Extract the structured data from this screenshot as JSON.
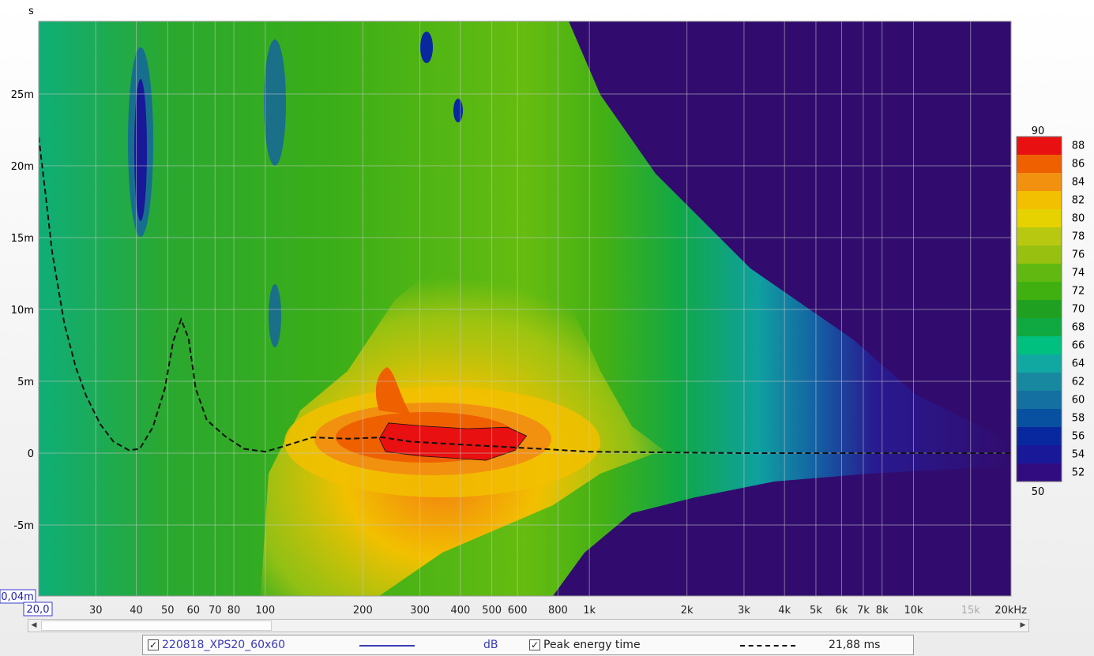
{
  "chart_data": {
    "type": "heatmap",
    "title": "",
    "x_axis": {
      "scale": "log",
      "range": [
        20,
        20000
      ],
      "start_label": "20,0",
      "tick_labels": [
        "30",
        "40",
        "50",
        "60",
        "70",
        "80",
        "100",
        "200",
        "300",
        "400",
        "500",
        "600",
        "800",
        "1k",
        "2k",
        "3k",
        "4k",
        "5k",
        "6k",
        "7k",
        "8k",
        "10k",
        "15k",
        "20kHz"
      ],
      "tick_values": [
        30,
        40,
        50,
        60,
        70,
        80,
        100,
        200,
        300,
        400,
        500,
        600,
        800,
        1000,
        2000,
        3000,
        4000,
        5000,
        6000,
        7000,
        8000,
        10000,
        15000,
        20000
      ]
    },
    "y_axis": {
      "unit_label": "s",
      "range": [
        -0.01,
        0.03
      ],
      "start_label": "0,04m",
      "tick_labels": [
        "25m",
        "20m",
        "15m",
        "10m",
        "5m",
        "0",
        "-5m"
      ],
      "tick_values": [
        0.025,
        0.02,
        0.015,
        0.01,
        0.005,
        0,
        -0.005
      ]
    },
    "color_scale": {
      "min_label": "50",
      "max_label": "90",
      "levels": [
        "88",
        "86",
        "84",
        "82",
        "80",
        "78",
        "76",
        "74",
        "72",
        "70",
        "68",
        "66",
        "64",
        "62",
        "60",
        "58",
        "56",
        "54",
        "52"
      ],
      "colors": [
        "#e81010",
        "#ee6000",
        "#f29010",
        "#f2c000",
        "#e6d200",
        "#b8c810",
        "#98c010",
        "#60b810",
        "#40b010",
        "#20a020",
        "#10a840",
        "#00c080",
        "#10a8a0",
        "#1888a0",
        "#1470a0",
        "#0850a0",
        "#0828a0",
        "#181898",
        "#300c80"
      ]
    },
    "peak_energy_time": {
      "points": [
        [
          20,
          0.022
        ],
        [
          21,
          0.018
        ],
        [
          22,
          0.014
        ],
        [
          24,
          0.009
        ],
        [
          26,
          0.006
        ],
        [
          28,
          0.004
        ],
        [
          31,
          0.002
        ],
        [
          34,
          0.0008
        ],
        [
          38,
          0.0002
        ],
        [
          41,
          0.0003
        ],
        [
          45,
          0.0018
        ],
        [
          49,
          0.0045
        ],
        [
          52,
          0.0078
        ],
        [
          55,
          0.0093
        ],
        [
          58,
          0.008
        ],
        [
          61,
          0.0045
        ],
        [
          66,
          0.0023
        ],
        [
          75,
          0.0012
        ],
        [
          86,
          0.0003
        ],
        [
          100,
          0.0001
        ],
        [
          115,
          0.0005
        ],
        [
          140,
          0.0011
        ],
        [
          180,
          0.001
        ],
        [
          230,
          0.0011
        ],
        [
          280,
          0.0008
        ],
        [
          400,
          0.0006
        ],
        [
          700,
          0.0003
        ],
        [
          1000,
          0.0001
        ],
        [
          3000,
          0
        ],
        [
          20000,
          0
        ]
      ]
    },
    "peak_region": [
      [
        225,
        0.001
      ],
      [
        240,
        0.0021
      ],
      [
        300,
        0.0019
      ],
      [
        420,
        0.0017
      ],
      [
        560,
        0.0018
      ],
      [
        640,
        0.0012
      ],
      [
        590,
        0.0002
      ],
      [
        480,
        -0.0005
      ],
      [
        300,
        -0.0002
      ],
      [
        235,
        0.0001
      ]
    ]
  },
  "legend": {
    "measurement_name": "220818_XPS20_60x60",
    "measurement_unit": "dB",
    "measurement_checked": "✓",
    "peak_label": "Peak energy time",
    "peak_checked": "✓",
    "peak_value": "21,88 ms",
    "measurement_color": "#3a3ab8"
  },
  "scrollbar": {
    "left_arrow": "◀",
    "right_arrow": "▶"
  }
}
